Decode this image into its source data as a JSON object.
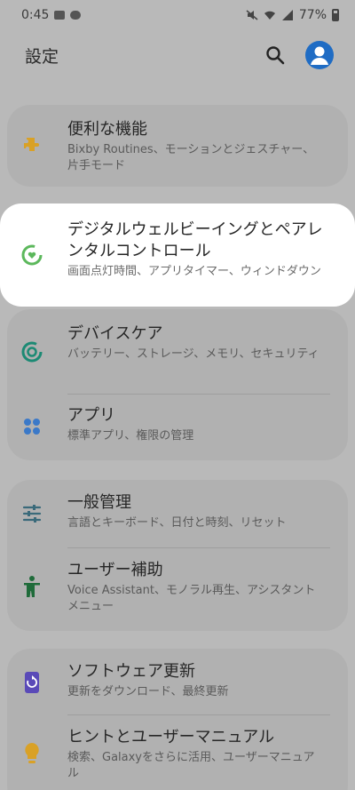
{
  "status": {
    "time": "0:45",
    "battery": "77%"
  },
  "header": {
    "title": "設定"
  },
  "cards": {
    "c1": {
      "items": [
        {
          "title": "便利な機能",
          "subtitle": "Bixby Routines、モーションとジェスチャー、片手モード",
          "icon": "puzzle-icon",
          "color": "#d9a126"
        }
      ]
    },
    "c2": {
      "items": [
        {
          "title": "デジタルウェルビーイングとペアレンタルコントロール",
          "subtitle": "画面点灯時間、アプリタイマー、ウィンドダウン",
          "icon": "wellbeing-icon",
          "color": "#5cb85c"
        }
      ]
    },
    "c3": {
      "items": [
        {
          "title": "デバイスケア",
          "subtitle": "バッテリー、ストレージ、メモリ、セキュリティ",
          "icon": "device-care-icon",
          "color": "#1c8a74"
        },
        {
          "title": "アプリ",
          "subtitle": "標準アプリ、権限の管理",
          "icon": "apps-icon",
          "color": "#3b79c8"
        }
      ]
    },
    "c4": {
      "items": [
        {
          "title": "一般管理",
          "subtitle": "言語とキーボード、日付と時刻、リセット",
          "icon": "sliders-icon",
          "color": "#3a6a7a"
        },
        {
          "title": "ユーザー補助",
          "subtitle": "Voice Assistant、モノラル再生、アシスタントメニュー",
          "icon": "accessibility-icon",
          "color": "#1f6b3a"
        }
      ]
    },
    "c5": {
      "items": [
        {
          "title": "ソフトウェア更新",
          "subtitle": "更新をダウンロード、最終更新",
          "icon": "update-icon",
          "color": "#5a4ab8"
        },
        {
          "title": "ヒントとユーザーマニュアル",
          "subtitle": "検索、Galaxyをさらに活用、ユーザーマニュアル",
          "icon": "lightbulb-icon",
          "color": "#d9a126"
        }
      ]
    }
  }
}
